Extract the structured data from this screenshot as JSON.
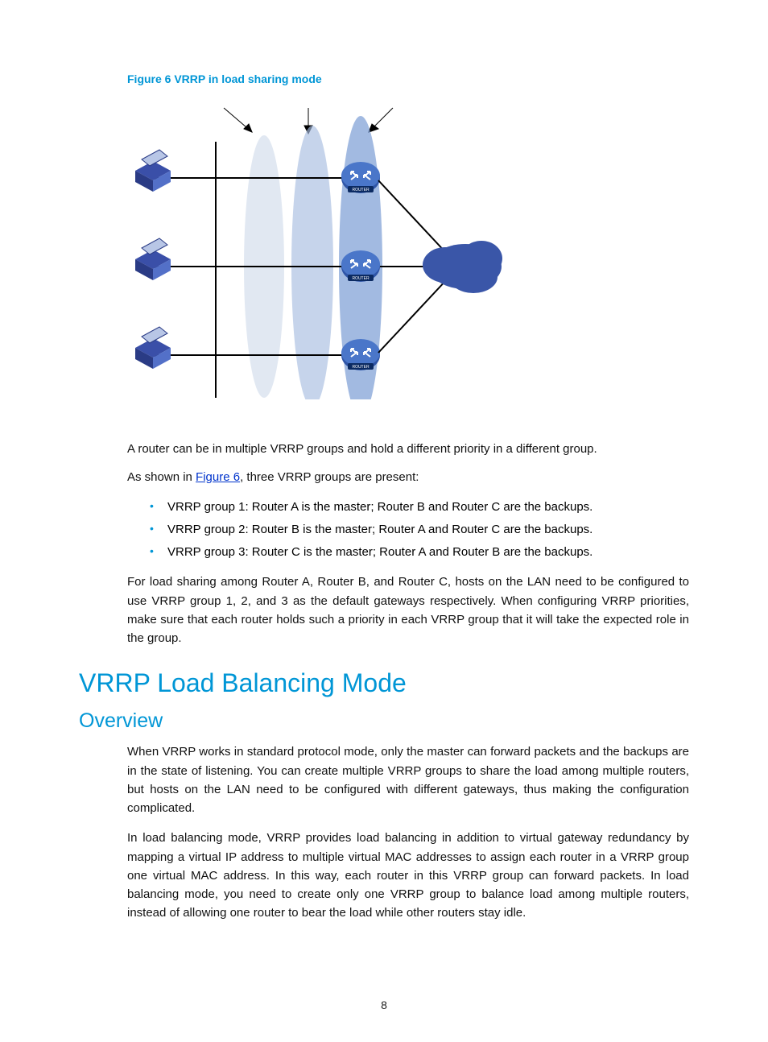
{
  "figure": {
    "caption": "Figure 6 VRRP in load sharing mode"
  },
  "intro1": "A router can be in multiple VRRP groups and hold a different priority in a different group.",
  "intro2_pre": "As shown in ",
  "intro2_link": "Figure 6",
  "intro2_post": ", three VRRP groups are present:",
  "list": [
    "VRRP group 1: Router A is the master; Router B and Router C are the backups.",
    "VRRP group 2: Router B is the master; Router A and Router C are the backups.",
    "VRRP group 3: Router C is the master; Router A and Router B are the backups."
  ],
  "para_after_list": "For load sharing among Router A, Router B, and Router C, hosts on the LAN need to be configured to use VRRP group 1, 2, and 3 as the default gateways respectively. When configuring VRRP priorities, make sure that each router holds such a priority in each VRRP group that it will take the expected role in the group.",
  "h1": "VRRP Load Balancing Mode",
  "h2": "Overview",
  "overview_p1": "When VRRP works in standard protocol mode, only the master can forward packets and the backups are in the state of listening. You can create multiple VRRP groups to share the load among multiple routers, but hosts on the LAN need to be configured with different gateways, thus making the configuration complicated.",
  "overview_p2": "In load balancing mode, VRRP provides load balancing in addition to virtual gateway redundancy by mapping a virtual IP address to multiple virtual MAC addresses to assign each router in a VRRP group one virtual MAC address. In this way, each router in this VRRP group can forward packets. In load balancing mode, you need to create only one VRRP group to balance load among multiple routers, instead of allowing one router to bear the load while other routers stay idle.",
  "page_number": "8"
}
